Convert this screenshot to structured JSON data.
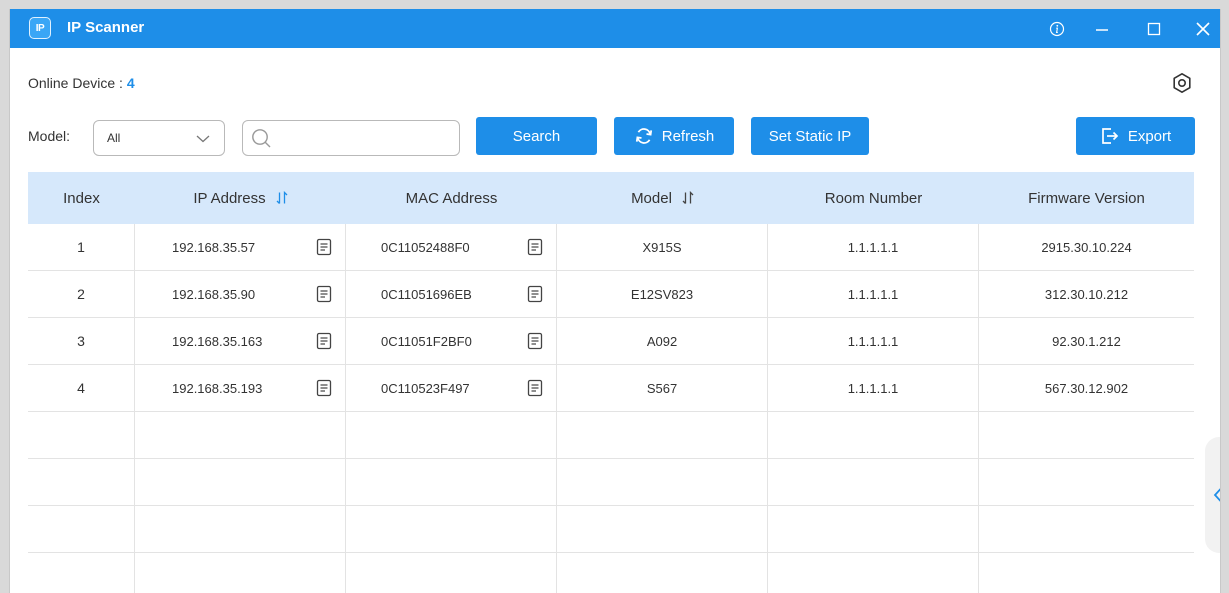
{
  "titlebar": {
    "app_icon_text": "IP",
    "title": "IP Scanner"
  },
  "online": {
    "label": "Online Device : ",
    "count": "4"
  },
  "filters": {
    "model_label": "Model:",
    "model_value": "All",
    "search_value": ""
  },
  "buttons": {
    "search": "Search",
    "refresh": "Refresh",
    "set_static_ip": "Set Static IP",
    "export": "Export"
  },
  "table": {
    "headers": {
      "index": "Index",
      "ip": "IP Address",
      "mac": "MAC Address",
      "model": "Model",
      "room": "Room Number",
      "firmware": "Firmware Version"
    },
    "rows": [
      {
        "index": "1",
        "ip": "192.168.35.57",
        "mac": "0C11052488F0",
        "model": "X915S",
        "room": "1.1.1.1.1",
        "firmware": "2915.30.10.224"
      },
      {
        "index": "2",
        "ip": "192.168.35.90",
        "mac": "0C11051696EB",
        "model": "E12SV823",
        "room": "1.1.1.1.1",
        "firmware": "312.30.10.212"
      },
      {
        "index": "3",
        "ip": "192.168.35.163",
        "mac": "0C11051F2BF0",
        "model": "A092",
        "room": "1.1.1.1.1",
        "firmware": "92.30.1.212"
      },
      {
        "index": "4",
        "ip": "192.168.35.193",
        "mac": "0C110523F497",
        "model": "S567",
        "room": "1.1.1.1.1",
        "firmware": "567.30.12.902"
      }
    ]
  },
  "colors": {
    "accent": "#1e8ee8",
    "header_bg": "#d6e8fb"
  },
  "icons": [
    "info-icon",
    "minimize-icon",
    "maximize-icon",
    "close-icon",
    "settings-icon",
    "chevron-down-icon",
    "search-icon",
    "refresh-icon",
    "export-icon",
    "sort-icon",
    "copy-icon",
    "chevron-left-icon"
  ]
}
